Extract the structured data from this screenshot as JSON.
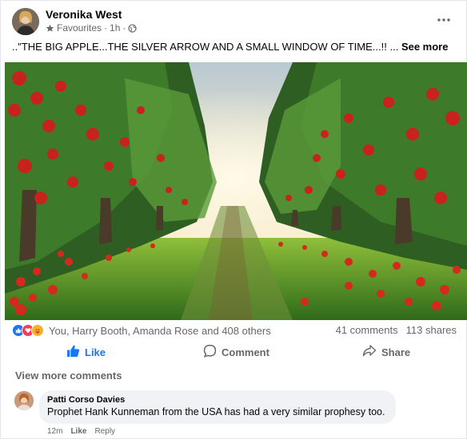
{
  "post": {
    "author": "Veronika West",
    "audience": "Favourites",
    "time": "1h",
    "caption": "..\"THE BIG APPLE...THE SILVER ARROW AND A SMALL WINDOW OF TIME...!! ...",
    "see_more": "See more"
  },
  "reactions": {
    "summary": "You, Harry Booth, Amanda Rose and 408 others",
    "comments": "41 comments",
    "shares": "113 shares"
  },
  "actions": {
    "like": "Like",
    "comment": "Comment",
    "share": "Share"
  },
  "view_more_comments": "View more comments",
  "comment": {
    "author": "Patti Corso Davies",
    "text": "Prophet Hank Kunneman from the USA has had a very similar prophesy too.",
    "time": "12m",
    "like": "Like",
    "reply": "Reply"
  },
  "colors": {
    "accent": "#1877f2",
    "muted": "#65676b"
  },
  "icons": [
    "more-options-icon",
    "star-icon",
    "globe-icon",
    "like-reaction-icon",
    "love-reaction-icon",
    "care-reaction-icon",
    "thumbs-up-icon",
    "comment-icon",
    "share-icon"
  ]
}
